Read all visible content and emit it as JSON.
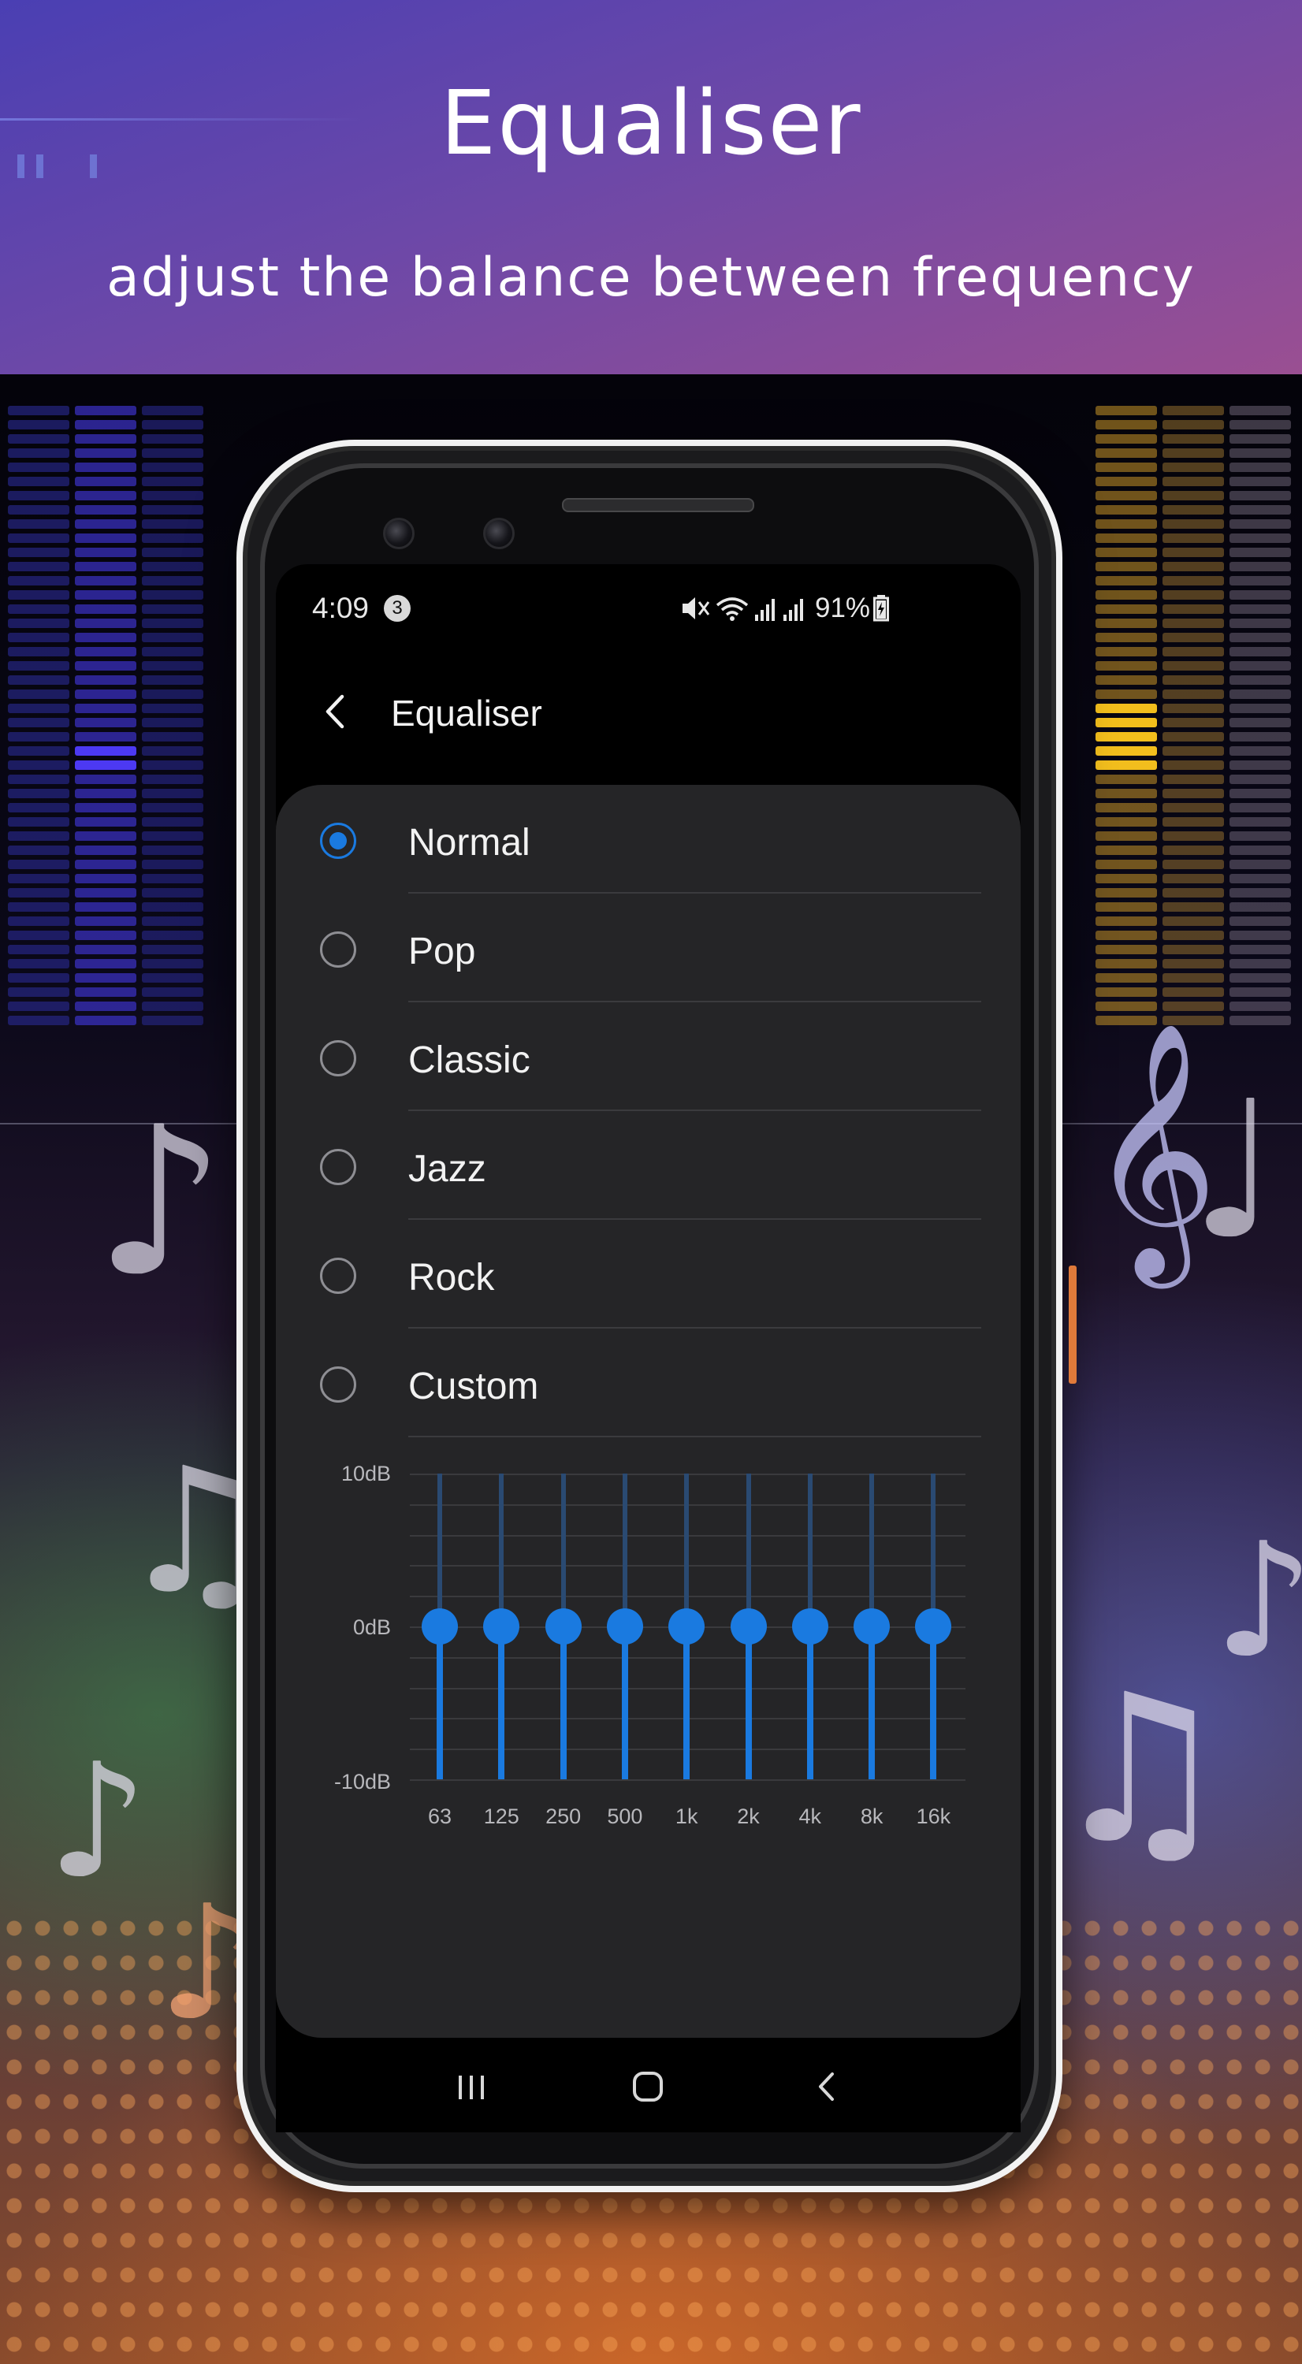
{
  "promo": {
    "title": "Equaliser",
    "subtitle": "adjust the balance between frequency"
  },
  "status_bar": {
    "time": "4:09",
    "notification_count": "3",
    "battery": "91%"
  },
  "app_bar": {
    "title": "Equaliser"
  },
  "presets": [
    {
      "label": "Normal",
      "selected": true
    },
    {
      "label": "Pop",
      "selected": false
    },
    {
      "label": "Classic",
      "selected": false
    },
    {
      "label": "Jazz",
      "selected": false
    },
    {
      "label": "Rock",
      "selected": false
    },
    {
      "label": "Custom",
      "selected": false
    }
  ],
  "equalizer": {
    "db_labels": [
      "10dB",
      "0dB",
      "-10dB"
    ],
    "range_db": [
      -10,
      10
    ],
    "bands": [
      {
        "label": "63",
        "gain_db": 0
      },
      {
        "label": "125",
        "gain_db": 0
      },
      {
        "label": "250",
        "gain_db": 0
      },
      {
        "label": "500",
        "gain_db": 0
      },
      {
        "label": "1k",
        "gain_db": 0
      },
      {
        "label": "2k",
        "gain_db": 0
      },
      {
        "label": "4k",
        "gain_db": 0
      },
      {
        "label": "8k",
        "gain_db": 0
      },
      {
        "label": "16k",
        "gain_db": 0
      }
    ]
  },
  "navigation_bar": {
    "icons": [
      "recent-apps-icon",
      "home-icon",
      "back-icon"
    ]
  },
  "colors": {
    "accent": "#1a7ae0",
    "card_background": "#252527",
    "screen_background": "#000000"
  }
}
